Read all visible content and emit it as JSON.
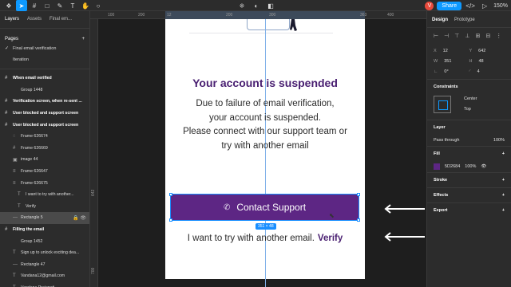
{
  "toolbar": {
    "tools": [
      "figma-menu-icon",
      "move-icon",
      "frame-icon",
      "shape-icon",
      "pen-icon",
      "text-icon",
      "hand-icon",
      "comment-icon"
    ],
    "center_tools": [
      "component-icon",
      "mask-icon",
      "boolean-icon"
    ],
    "user_initial": "V",
    "share_label": "Share",
    "code_label": "</>",
    "zoom": "150%"
  },
  "left_panel": {
    "tabs": [
      "Layers",
      "Assets",
      "Final em..."
    ],
    "pages_label": "Pages",
    "add_label": "+",
    "pages": [
      {
        "label": "Final email verification",
        "checked": "✓"
      },
      {
        "label": "Iteration",
        "checked": ""
      }
    ],
    "layers": [
      {
        "icon": "#",
        "label": "When email verified",
        "depth": 0,
        "bold": true,
        "tail": ""
      },
      {
        "icon": "",
        "label": "Group 1448",
        "depth": 1,
        "bold": false,
        "tail": ""
      },
      {
        "icon": "#",
        "label": "Verification screen, when re-sent ...",
        "depth": 0,
        "bold": true,
        "tail": ""
      },
      {
        "icon": "#",
        "label": "User blocked and support screen",
        "depth": 0,
        "bold": true,
        "tail": ""
      },
      {
        "icon": "#",
        "label": "User blocked and support screen",
        "depth": 0,
        "bold": true,
        "tail": ""
      },
      {
        "icon": "◌",
        "label": "Frame 626674",
        "depth": 1,
        "bold": false,
        "tail": ""
      },
      {
        "icon": "#",
        "label": "Frame 626669",
        "depth": 1,
        "bold": false,
        "tail": ""
      },
      {
        "icon": "▣",
        "label": "image 44",
        "depth": 1,
        "bold": false,
        "tail": ""
      },
      {
        "icon": "≡",
        "label": "Frame 626647",
        "depth": 1,
        "bold": false,
        "tail": ""
      },
      {
        "icon": "≡",
        "label": "Frame 626675",
        "depth": 1,
        "bold": false,
        "tail": ""
      },
      {
        "icon": "T",
        "label": "I want to try with another...",
        "depth": 2,
        "bold": false,
        "tail": ""
      },
      {
        "icon": "T",
        "label": "Verify",
        "depth": 2,
        "bold": false,
        "tail": ""
      },
      {
        "icon": "—",
        "label": "Rectangle 5",
        "depth": 1,
        "bold": false,
        "tail": "🔒 👁",
        "selected": true
      },
      {
        "icon": "#",
        "label": "Filling the email",
        "depth": 0,
        "bold": true,
        "tail": ""
      },
      {
        "icon": "",
        "label": "Group 1452",
        "depth": 1,
        "bold": false,
        "tail": ""
      },
      {
        "icon": "T",
        "label": "Sign up to unlock exciting dea...",
        "depth": 1,
        "bold": false,
        "tail": ""
      },
      {
        "icon": "—",
        "label": "Rectangle 47",
        "depth": 1,
        "bold": false,
        "tail": ""
      },
      {
        "icon": "T",
        "label": "Vandana12@gmail.com",
        "depth": 1,
        "bold": false,
        "tail": ""
      },
      {
        "icon": "T",
        "label": "Vandana Prajapati",
        "depth": 1,
        "bold": false,
        "tail": ""
      }
    ]
  },
  "rulers": {
    "h": [
      "100",
      "200",
      "12",
      "200",
      "300",
      "363",
      "400"
    ],
    "v": [
      "642",
      "700"
    ]
  },
  "canvas": {
    "title": "Your account is suspended",
    "body_lines": [
      "Due to failure of email verification,",
      "your account is suspended.",
      "Please connect with our support team or",
      "try with another email"
    ],
    "button_label": "Contact Support",
    "phone_icon": "✆",
    "selection_size": "351 × 48",
    "footer_text": "I want to try with another email.",
    "footer_link": "Verify"
  },
  "right_panel": {
    "tabs": [
      "Design",
      "Prototype"
    ],
    "align_icons": [
      "⊢",
      "⊣",
      "⊤",
      "⊥",
      "⊞",
      "⊟",
      "⋮"
    ],
    "x_label": "X",
    "x": "12",
    "y_label": "Y",
    "y": "642",
    "w_label": "W",
    "w": "351",
    "h_label": "H",
    "h": "48",
    "rot": "0°",
    "radius": "4",
    "constraints_label": "Constraints",
    "constraint_h": "Center",
    "constraint_v": "Top",
    "layer_label": "Layer",
    "blend": "Pass through",
    "opacity": "100%",
    "fill_label": "Fill",
    "fill_hex": "5D2684",
    "fill_opacity": "100%",
    "stroke_label": "Stroke",
    "effects_label": "Effects",
    "export_label": "Export"
  },
  "colors": {
    "accent": "#0d99ff",
    "brand_purple": "#5d2684",
    "title_purple": "#4a2072"
  }
}
